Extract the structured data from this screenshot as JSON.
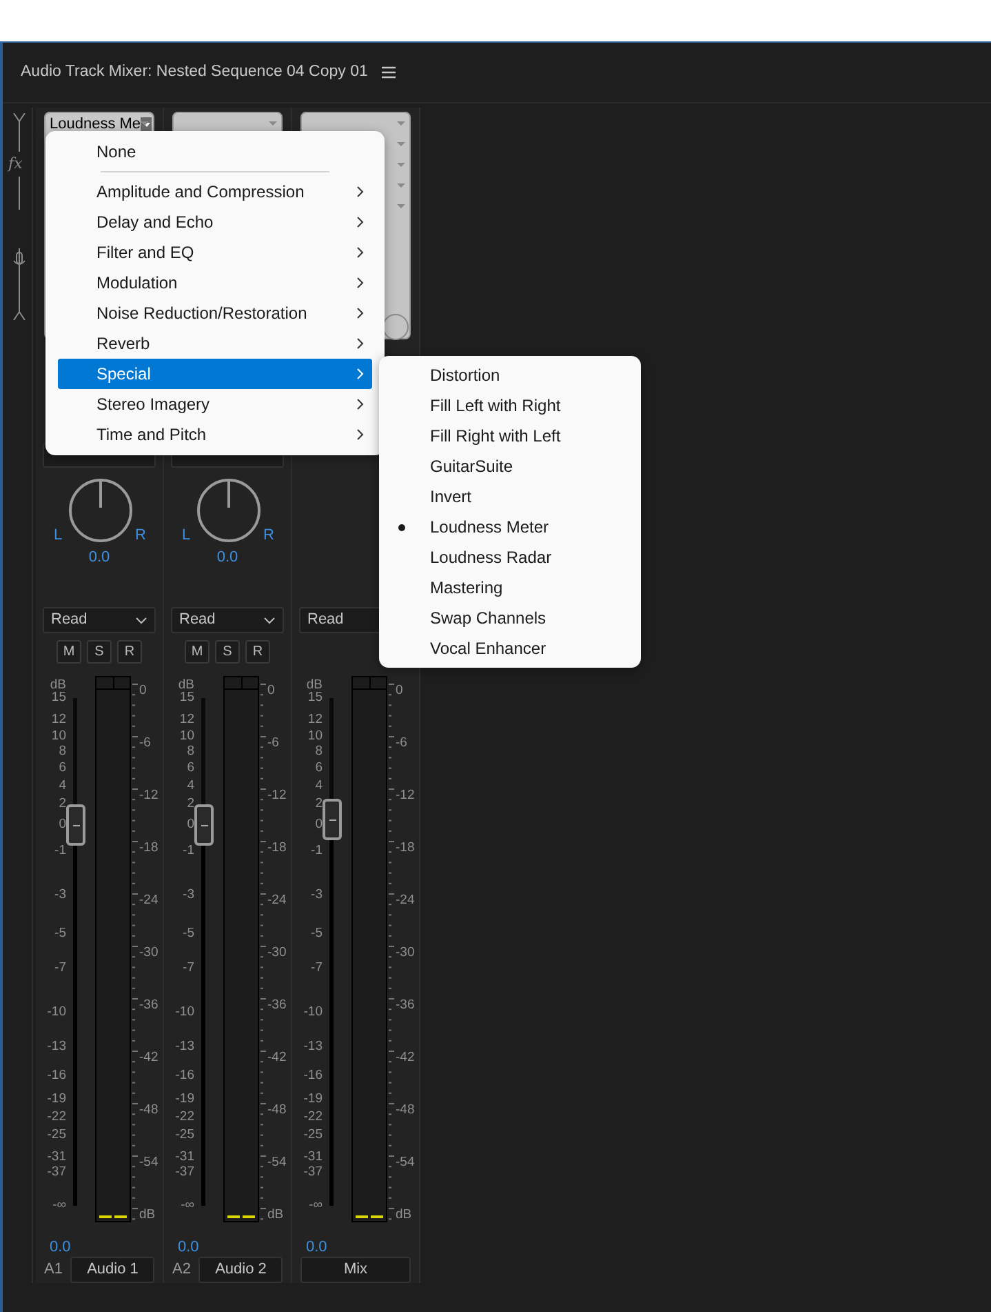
{
  "panel": {
    "title": "Audio Track Mixer: Nested Sequence 04 Copy 01"
  },
  "sidebar": {
    "effects_label": "fx"
  },
  "channels": [
    {
      "kind": "track",
      "effect_slot": "Loudness Me",
      "automation": "Read",
      "buttons": [
        "M",
        "S",
        "R"
      ],
      "pan_left": "L",
      "pan_right": "R",
      "pan_value": "0.0",
      "fader_scale": [
        "dB",
        "15",
        "12",
        "10",
        "8",
        "6",
        "4",
        "2",
        "0",
        "-1",
        "-3",
        "-5",
        "-7",
        "-10",
        "-13",
        "-16",
        "-19",
        "-22",
        "-25",
        "-31",
        "-37",
        "-∞"
      ],
      "meter_scale": [
        "0",
        "-6",
        "-12",
        "-18",
        "-24",
        "-30",
        "-36",
        "-42",
        "-48",
        "-54",
        "dB"
      ],
      "fader": {
        "level": 0.75
      },
      "volume": "0.0",
      "track_id": "A1",
      "name": "Audio 1"
    },
    {
      "kind": "track",
      "automation": "Read",
      "buttons": [
        "M",
        "S",
        "R"
      ],
      "pan_left": "L",
      "pan_right": "R",
      "pan_value": "0.0",
      "fader_scale": [
        "dB",
        "15",
        "12",
        "10",
        "8",
        "6",
        "4",
        "2",
        "0",
        "-1",
        "-3",
        "-5",
        "-7",
        "-10",
        "-13",
        "-16",
        "-19",
        "-22",
        "-25",
        "-31",
        "-37",
        "-∞"
      ],
      "meter_scale": [
        "0",
        "-6",
        "-12",
        "-18",
        "-24",
        "-30",
        "-36",
        "-42",
        "-48",
        "-54",
        "dB"
      ],
      "fader": {
        "level": 0.75
      },
      "volume": "0.0",
      "track_id": "A2",
      "name": "Audio 2"
    },
    {
      "kind": "master",
      "automation": "Read",
      "fader_scale": [
        "dB",
        "15",
        "12",
        "10",
        "8",
        "6",
        "4",
        "2",
        "0",
        "-1",
        "-3",
        "-5",
        "-7",
        "-10",
        "-13",
        "-16",
        "-19",
        "-22",
        "-25",
        "-31",
        "-37",
        "-∞"
      ],
      "meter_scale": [
        "0",
        "-6",
        "-12",
        "-18",
        "-24",
        "-30",
        "-36",
        "-42",
        "-48",
        "-54",
        "dB"
      ],
      "fader": {
        "level": 0.76
      },
      "volume": "0.0",
      "name": "Mix"
    }
  ],
  "effect_menu": {
    "items": [
      {
        "kind": "item",
        "label": "None",
        "has_submenu": false,
        "selected": false
      },
      {
        "kind": "separator"
      },
      {
        "kind": "item",
        "label": "Amplitude and Compression",
        "has_submenu": true,
        "selected": false
      },
      {
        "kind": "item",
        "label": "Delay and Echo",
        "has_submenu": true,
        "selected": false
      },
      {
        "kind": "item",
        "label": "Filter and EQ",
        "has_submenu": true,
        "selected": false
      },
      {
        "kind": "item",
        "label": "Modulation",
        "has_submenu": true,
        "selected": false
      },
      {
        "kind": "item",
        "label": "Noise Reduction/Restoration",
        "has_submenu": true,
        "selected": false
      },
      {
        "kind": "item",
        "label": "Reverb",
        "has_submenu": true,
        "selected": false
      },
      {
        "kind": "item",
        "label": "Special",
        "has_submenu": true,
        "selected": true
      },
      {
        "kind": "item",
        "label": "Stereo Imagery",
        "has_submenu": true,
        "selected": false
      },
      {
        "kind": "item",
        "label": "Time and Pitch",
        "has_submenu": true,
        "selected": false
      }
    ]
  },
  "submenu": {
    "items": [
      {
        "label": "Distortion",
        "checked": false
      },
      {
        "label": "Fill Left with Right",
        "checked": false
      },
      {
        "label": "Fill Right with Left",
        "checked": false
      },
      {
        "label": "GuitarSuite",
        "checked": false
      },
      {
        "label": "Invert",
        "checked": false
      },
      {
        "label": "Loudness Meter",
        "checked": true
      },
      {
        "label": "Loudness Radar",
        "checked": false
      },
      {
        "label": "Mastering",
        "checked": false
      },
      {
        "label": "Swap Channels",
        "checked": false
      },
      {
        "label": "Vocal Enhancer",
        "checked": false
      }
    ]
  }
}
